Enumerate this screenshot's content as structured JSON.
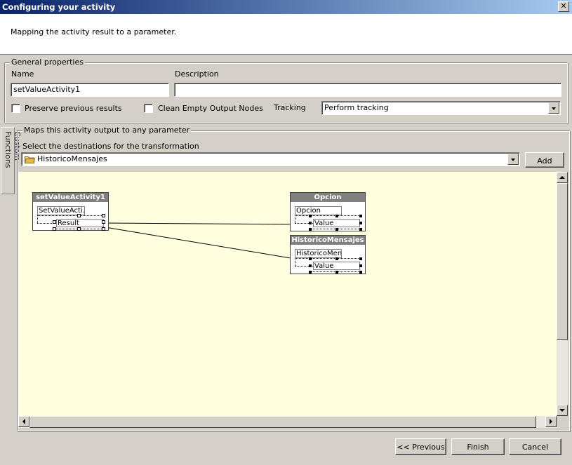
{
  "window": {
    "title": "Configuring your activity",
    "close_label": "✕"
  },
  "header": {
    "subtitle": "Mapping the activity result to a parameter."
  },
  "general": {
    "legend": "General properties",
    "name_label": "Name",
    "name_value": "setValueActivity1",
    "description_label": "Description",
    "description_value": "",
    "preserve_label": "Preserve previous results",
    "clean_label": "Clean Empty Output Nodes",
    "tracking_label": "Tracking",
    "tracking_value": "Perform tracking"
  },
  "sidetab": {
    "label": "Custom Functions"
  },
  "mapping": {
    "legend": "Maps this activity output to any parameter",
    "select_label": "Select the destinations for the transformation",
    "destination_value": "HistoricoMensajes",
    "add_label": "Add"
  },
  "diagram": {
    "source": {
      "title": "setValueActivity1",
      "fields": [
        "SetValueActi...",
        "Result"
      ]
    },
    "targets": [
      {
        "title": "Opcion",
        "fields": [
          "Opcion",
          "Value"
        ]
      },
      {
        "title": "HistoricoMensajes",
        "fields": [
          "HistoricoMen...",
          "Value"
        ]
      }
    ]
  },
  "footer": {
    "previous_label": "<< Previous",
    "finish_label": "Finish",
    "cancel_label": "Cancel"
  }
}
